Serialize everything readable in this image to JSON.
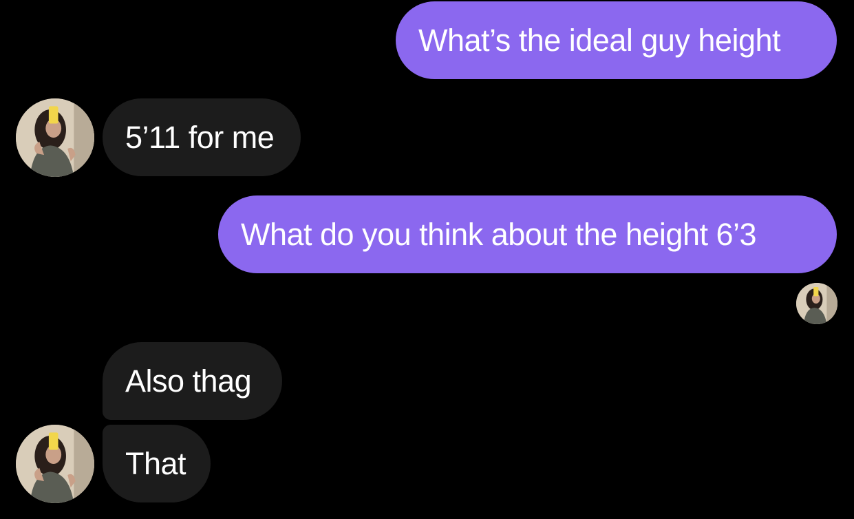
{
  "conversation": {
    "messages": [
      {
        "from": "me",
        "text": "What’s the ideal guy height"
      },
      {
        "from": "them",
        "text": "5’11 for me"
      },
      {
        "from": "me",
        "text": "What do you think about the height 6’3"
      },
      {
        "from": "them",
        "text": "Also thag"
      },
      {
        "from": "them",
        "text": "That"
      }
    ],
    "read_receipt": {
      "icon": "contact-avatar-read-receipt"
    },
    "colors": {
      "background": "#000000",
      "sent_bubble": "#8b68ef",
      "received_bubble": "#1c1c1c",
      "text": "#ffffff"
    }
  }
}
